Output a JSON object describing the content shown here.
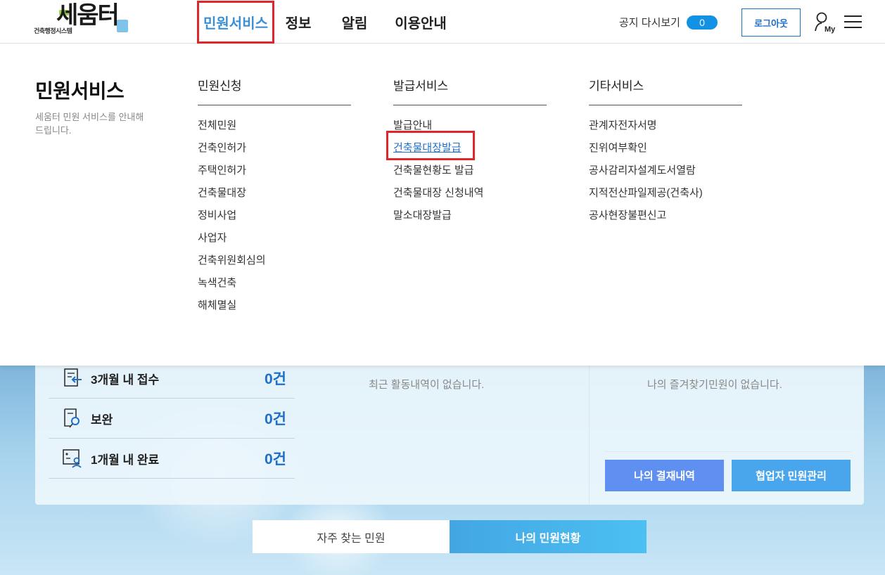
{
  "header": {
    "logo_sub": "건축행정시스템",
    "logo_main": "세움터",
    "nav": [
      {
        "label": "민원서비스"
      },
      {
        "label": "정보"
      },
      {
        "label": "알림"
      },
      {
        "label": "이용안내"
      }
    ],
    "notice_label": "공지 다시보기",
    "notice_count": "0",
    "logout_label": "로그아웃"
  },
  "mega_menu": {
    "title": "민원서비스",
    "description": "세움터 민원 서비스를 안내해드립니다.",
    "columns": [
      {
        "heading": "민원신청",
        "items": [
          "전체민원",
          "건축인허가",
          "주택인허가",
          "건축물대장",
          "정비사업",
          "사업자",
          "건축위원회심의",
          "녹색건축",
          "해체멸실"
        ]
      },
      {
        "heading": "발급서비스",
        "items": [
          "발급안내",
          "건축물대장발급",
          "건축물현황도 발급",
          "건축물대장 신청내역",
          "말소대장발급"
        ]
      },
      {
        "heading": "기타서비스",
        "items": [
          "관계자전자서명",
          "진위여부확인",
          "공사감리자설계도서열람",
          "지적전산파일제공(건축사)",
          "공사현장불편신고"
        ]
      }
    ]
  },
  "status": {
    "rows": [
      {
        "label": "3개월 내 접수",
        "count": "0건"
      },
      {
        "label": "보완",
        "count": "0건"
      },
      {
        "label": "1개월 내 완료",
        "count": "0건"
      }
    ],
    "activity_empty": "최근 활동내역이 없습니다.",
    "favorites_empty": "나의 즐겨찾기민원이 없습니다.",
    "payment_button": "나의 결재내역",
    "coop_button": "협업자 민원관리"
  },
  "bottom_tabs": [
    {
      "label": "자주 찾는 민원"
    },
    {
      "label": "나의 민원현황"
    }
  ],
  "colors": {
    "accent_blue": "#1f6fc9",
    "nav_active": "#3d8fd4",
    "highlight_red": "#e0262a",
    "badge_blue": "#1392e5"
  }
}
